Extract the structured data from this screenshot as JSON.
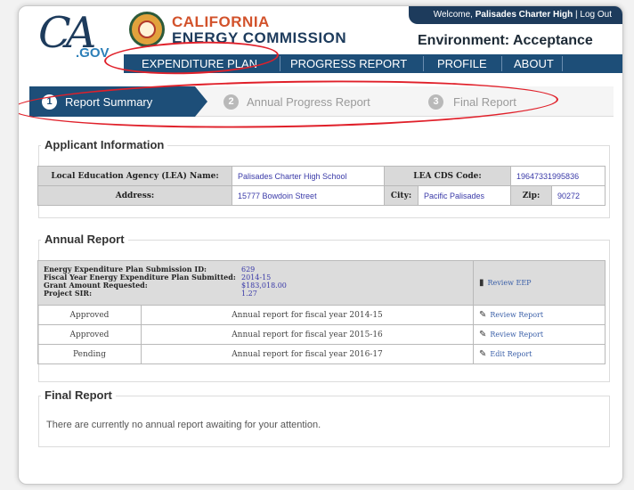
{
  "header": {
    "logo": {
      "main": "CA",
      "suffix": ".GOV"
    },
    "agency": {
      "line1": "CALIFORNIA",
      "line2": "ENERGY COMMISSION"
    },
    "user": {
      "welcome": "Welcome,",
      "name": "Palisades Charter High",
      "separator": "|",
      "logout": "Log Out"
    },
    "environment": "Environment: Acceptance",
    "nav": [
      "EXPENDITURE PLAN",
      "PROGRESS REPORT",
      "PROFILE",
      "ABOUT"
    ]
  },
  "steps": [
    {
      "num": "1",
      "label": "Report Summary",
      "active": true
    },
    {
      "num": "2",
      "label": "Annual Progress Report",
      "active": false
    },
    {
      "num": "3",
      "label": "Final Report",
      "active": false
    }
  ],
  "applicant": {
    "title": "Applicant Information",
    "lea_name_label": "Local Education Agency (LEA) Name:",
    "lea_name": "Palisades Charter High School",
    "cds_label": "LEA CDS Code:",
    "cds": "19647331995836",
    "address_label": "Address:",
    "address": "15777 Bowdoin Street",
    "city_label": "City:",
    "city": "Pacific Palisades",
    "zip_label": "Zip:",
    "zip": "90272"
  },
  "annual": {
    "title": "Annual Report",
    "summary": [
      {
        "label": "Energy Expenditure Plan Submission ID:",
        "value": "629"
      },
      {
        "label": "Fiscal Year Energy Expenditure Plan Submitted:",
        "value": "2014-15"
      },
      {
        "label": "Grant Amount Requested:",
        "value": "$183,018.00"
      },
      {
        "label": "Project SIR:",
        "value": "1.27"
      }
    ],
    "review_eep": "Review EEP",
    "rows": [
      {
        "status": "Approved",
        "desc": "Annual report for fiscal year 2014-15",
        "action": "Review Report"
      },
      {
        "status": "Approved",
        "desc": "Annual report for fiscal year 2015-16",
        "action": "Review Report"
      },
      {
        "status": "Pending",
        "desc": "Annual report for fiscal year 2016-17",
        "action": "Edit Report"
      }
    ]
  },
  "final": {
    "title": "Final Report",
    "message": "There are currently no annual report awaiting for your attention."
  },
  "colors": {
    "navy": "#1d4e78",
    "brand_orange": "#d2522b",
    "annotation_red": "#e0202a",
    "link_blue": "#3a3aa8"
  },
  "icons": {
    "review_eep": "document-icon",
    "review_report": "edit-icon"
  }
}
